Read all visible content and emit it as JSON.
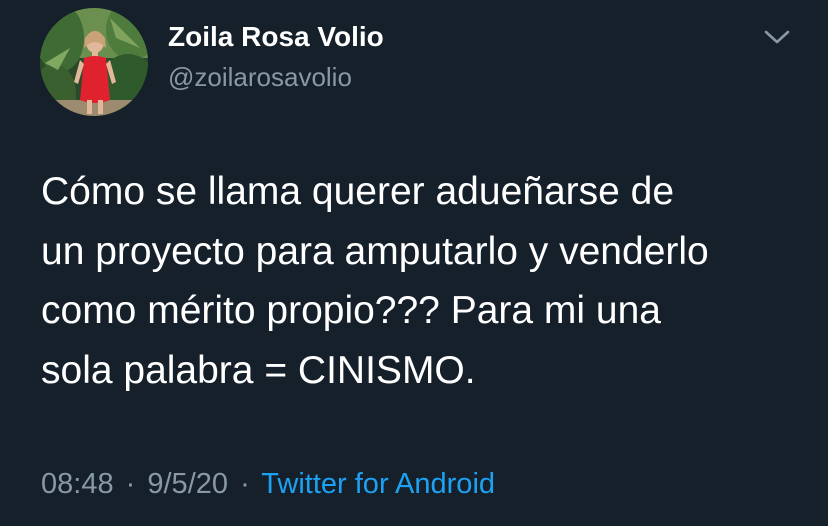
{
  "tweet": {
    "author": {
      "display_name": "Zoila Rosa Volio",
      "handle": "@zoilarosavolio"
    },
    "body_lines": [
      "Cómo se llama querer adueñarse de",
      "un proyecto para amputarlo y venderlo",
      "como mérito propio??? Para mi una",
      "sola palabra = CINISMO."
    ],
    "meta": {
      "time": "08:48",
      "date": "9/5/20",
      "separator": "·",
      "source": "Twitter for Android"
    }
  },
  "icons": {
    "menu": "chevron-down-icon",
    "avatar": "profile-photo"
  },
  "colors": {
    "background": "#15202b",
    "primary_text": "#ffffff",
    "secondary_text": "#8899a6",
    "link": "#1da1f2"
  }
}
